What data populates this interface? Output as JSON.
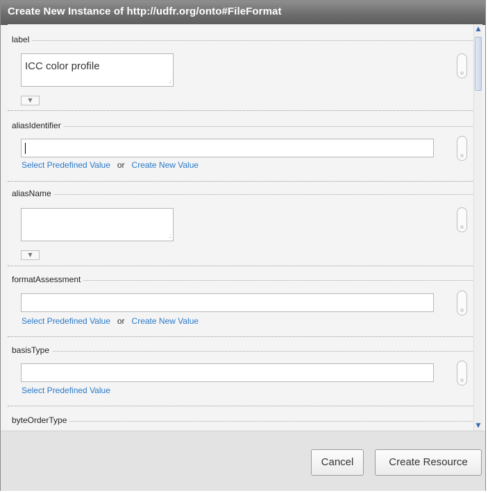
{
  "dialog": {
    "title": "Create New Instance of http://udfr.org/onto#FileFormat"
  },
  "fields": {
    "label": {
      "name": "label",
      "value": "ICC color profile"
    },
    "aliasIdentifier": {
      "name": "aliasIdentifier",
      "value": "",
      "select_link": "Select Predefined Value",
      "or": "or",
      "create_link": "Create New Value"
    },
    "aliasName": {
      "name": "aliasName",
      "value": ""
    },
    "formatAssessment": {
      "name": "formatAssessment",
      "value": "",
      "select_link": "Select Predefined Value",
      "or": "or",
      "create_link": "Create New Value"
    },
    "basisType": {
      "name": "basisType",
      "value": "",
      "select_link": "Select Predefined Value"
    },
    "byteOrderType": {
      "name": "byteOrderType"
    }
  },
  "icons": {
    "expand": "expand-arrow-icon",
    "add": "add-value-icon",
    "resize": "resize-grip-icon"
  },
  "buttons": {
    "cancel": "Cancel",
    "create": "Create Resource"
  },
  "colors": {
    "link": "#2a78c8",
    "titlebar": "#6c6c6c"
  }
}
